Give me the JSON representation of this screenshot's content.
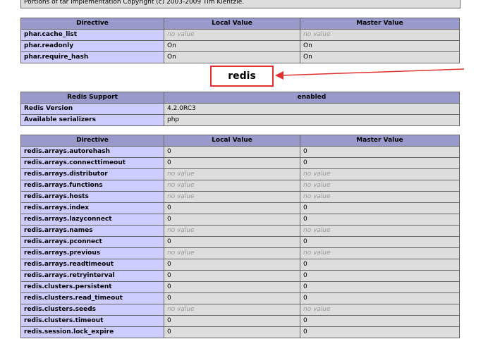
{
  "copyright_text": "Portions of tar implementation Copyright (c) 2003-2009 Tim Kientzle.",
  "phar_table": {
    "headers": [
      "Directive",
      "Local Value",
      "Master Value"
    ],
    "rows": [
      {
        "name": "phar.cache_list",
        "local": "no value",
        "master": "no value"
      },
      {
        "name": "phar.readonly",
        "local": "On",
        "master": "On"
      },
      {
        "name": "phar.require_hash",
        "local": "On",
        "master": "On"
      }
    ]
  },
  "section_title": "redis",
  "redis_support": {
    "header_left": "Redis Support",
    "header_right": "enabled",
    "rows": [
      {
        "name": "Redis Version",
        "value": "4.2.0RC3"
      },
      {
        "name": "Available serializers",
        "value": "php"
      }
    ]
  },
  "redis_table": {
    "headers": [
      "Directive",
      "Local Value",
      "Master Value"
    ],
    "rows": [
      {
        "name": "redis.arrays.autorehash",
        "local": "0",
        "master": "0"
      },
      {
        "name": "redis.arrays.connecttimeout",
        "local": "0",
        "master": "0"
      },
      {
        "name": "redis.arrays.distributor",
        "local": "no value",
        "master": "no value"
      },
      {
        "name": "redis.arrays.functions",
        "local": "no value",
        "master": "no value"
      },
      {
        "name": "redis.arrays.hosts",
        "local": "no value",
        "master": "no value"
      },
      {
        "name": "redis.arrays.index",
        "local": "0",
        "master": "0"
      },
      {
        "name": "redis.arrays.lazyconnect",
        "local": "0",
        "master": "0"
      },
      {
        "name": "redis.arrays.names",
        "local": "no value",
        "master": "no value"
      },
      {
        "name": "redis.arrays.pconnect",
        "local": "0",
        "master": "0"
      },
      {
        "name": "redis.arrays.previous",
        "local": "no value",
        "master": "no value"
      },
      {
        "name": "redis.arrays.readtimeout",
        "local": "0",
        "master": "0"
      },
      {
        "name": "redis.arrays.retryinterval",
        "local": "0",
        "master": "0"
      },
      {
        "name": "redis.clusters.persistent",
        "local": "0",
        "master": "0"
      },
      {
        "name": "redis.clusters.read_timeout",
        "local": "0",
        "master": "0"
      },
      {
        "name": "redis.clusters.seeds",
        "local": "no value",
        "master": "no value"
      },
      {
        "name": "redis.clusters.timeout",
        "local": "0",
        "master": "0"
      },
      {
        "name": "redis.session.lock_expire",
        "local": "0",
        "master": "0"
      }
    ]
  },
  "colors": {
    "annotation": "#e03030",
    "header": "#9999cc",
    "name_cell": "#ccccff",
    "value_cell": "#dddddd"
  }
}
